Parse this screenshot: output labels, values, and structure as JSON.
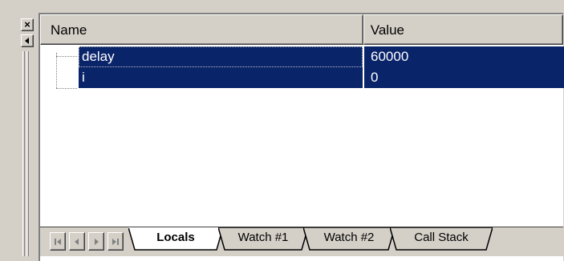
{
  "columns": {
    "name": "Name",
    "value": "Value"
  },
  "rows": [
    {
      "name": "delay",
      "value": "60000"
    },
    {
      "name": "i",
      "value": "0"
    }
  ],
  "tabs": [
    {
      "label": "Locals",
      "active": true
    },
    {
      "label": "Watch #1",
      "active": false
    },
    {
      "label": "Watch #2",
      "active": false
    },
    {
      "label": "Call Stack",
      "active": false
    }
  ],
  "icons": {
    "close": "×",
    "first": "first-icon",
    "prev": "prev-icon",
    "next": "next-icon",
    "last": "last-icon"
  },
  "colors": {
    "selection": "#0a246a",
    "chrome": "#d4d0c8"
  }
}
